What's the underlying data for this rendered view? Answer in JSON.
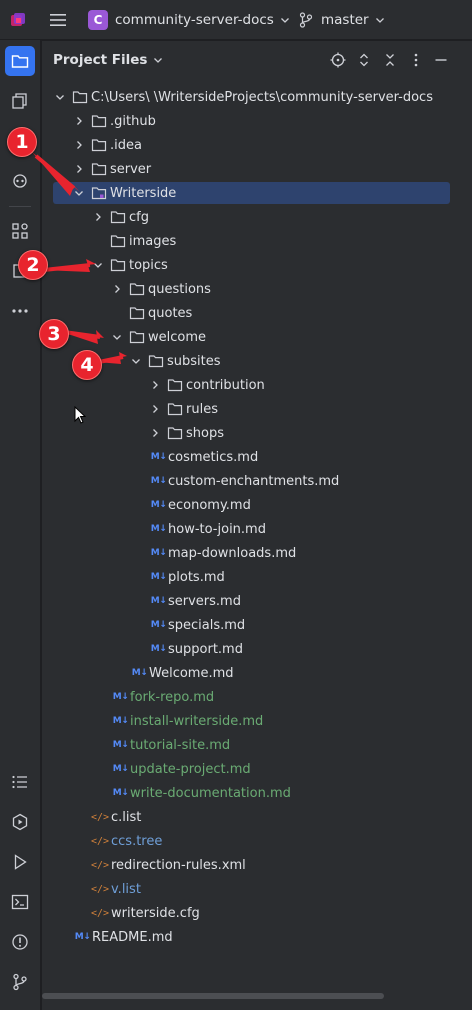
{
  "titlebar": {
    "project_badge": "C",
    "project_name": "community-server-docs",
    "branch_name": "master"
  },
  "panel": {
    "title": "Project Files"
  },
  "tree": [
    {
      "label": "C:\\Users\\          \\WritersideProjects\\community-server-docs",
      "type": "folder",
      "expanded": true,
      "level": 0
    },
    {
      "label": ".github",
      "type": "folder",
      "expanded": false,
      "level": 1
    },
    {
      "label": ".idea",
      "type": "folder",
      "expanded": false,
      "level": 1
    },
    {
      "label": "server",
      "type": "folder",
      "expanded": false,
      "level": 1
    },
    {
      "label": "Writerside",
      "type": "folder",
      "expanded": true,
      "level": 1,
      "selected": true
    },
    {
      "label": "cfg",
      "type": "folder",
      "expanded": false,
      "level": 2
    },
    {
      "label": "images",
      "type": "folder",
      "leaf": true,
      "level": 2
    },
    {
      "label": "topics",
      "type": "folder",
      "expanded": true,
      "level": 2
    },
    {
      "label": "questions",
      "type": "folder",
      "expanded": false,
      "level": 3
    },
    {
      "label": "quotes",
      "type": "folder",
      "leaf": true,
      "level": 3
    },
    {
      "label": "welcome",
      "type": "folder",
      "expanded": true,
      "level": 3
    },
    {
      "label": "subsites",
      "type": "folder",
      "expanded": true,
      "level": 4
    },
    {
      "label": "contribution",
      "type": "folder",
      "expanded": false,
      "level": 5
    },
    {
      "label": "rules",
      "type": "folder",
      "expanded": false,
      "level": 5
    },
    {
      "label": "shops",
      "type": "folder",
      "expanded": false,
      "level": 5
    },
    {
      "label": "cosmetics.md",
      "type": "md",
      "level": 5
    },
    {
      "label": "custom-enchantments.md",
      "type": "md",
      "level": 5
    },
    {
      "label": "economy.md",
      "type": "md",
      "level": 5
    },
    {
      "label": "how-to-join.md",
      "type": "md",
      "level": 5
    },
    {
      "label": "map-downloads.md",
      "type": "md",
      "level": 5
    },
    {
      "label": "plots.md",
      "type": "md",
      "level": 5
    },
    {
      "label": "servers.md",
      "type": "md",
      "level": 5
    },
    {
      "label": "specials.md",
      "type": "md",
      "level": 5
    },
    {
      "label": "support.md",
      "type": "md",
      "level": 5
    },
    {
      "label": "Welcome.md",
      "type": "md",
      "level": 4
    },
    {
      "label": "fork-repo.md",
      "type": "md",
      "level": 3,
      "color": "green"
    },
    {
      "label": "install-writerside.md",
      "type": "md",
      "level": 3,
      "color": "green"
    },
    {
      "label": "tutorial-site.md",
      "type": "md",
      "level": 3,
      "color": "green"
    },
    {
      "label": "update-project.md",
      "type": "md",
      "level": 3,
      "color": "green"
    },
    {
      "label": "write-documentation.md",
      "type": "md",
      "level": 3,
      "color": "green"
    },
    {
      "label": "c.list",
      "type": "code",
      "level": 2
    },
    {
      "label": "ccs.tree",
      "type": "code",
      "level": 2,
      "color": "blue"
    },
    {
      "label": "redirection-rules.xml",
      "type": "code",
      "level": 2
    },
    {
      "label": "v.list",
      "type": "code",
      "level": 2,
      "color": "blue"
    },
    {
      "label": "writerside.cfg",
      "type": "code",
      "level": 2
    },
    {
      "label": "README.md",
      "type": "md",
      "level": 1
    }
  ],
  "markers": [
    "1",
    "2",
    "3",
    "4"
  ],
  "colors": {
    "accent": "#3574f0",
    "selection": "#2e436e",
    "marker": "#e8242e",
    "md_icon": "#548af7",
    "vcs_added": "#6aab73",
    "vcs_modified": "#6f9fd8"
  }
}
